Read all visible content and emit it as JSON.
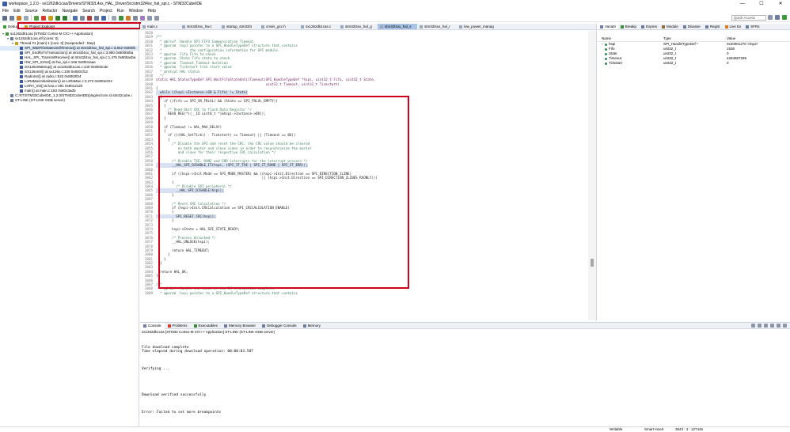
{
  "window": {
    "title": "workspace_1.2.0 - sx1262dk1cas/Drivers/STM32L4xx_HAL_Driver/Src/stm32l4xx_hal_spi.c - STM32CubeIDE",
    "minimize": "—",
    "maximize": "☐",
    "close": "✕"
  },
  "menu": [
    "File",
    "Edit",
    "Source",
    "Refactor",
    "Navigate",
    "Search",
    "Project",
    "Run",
    "Window",
    "Help"
  ],
  "toolbar": {
    "quick_access_placeholder": "Quick Access",
    "icon_colors": [
      "#5b6c8a",
      "#6f7f99",
      "#d47b22",
      "#9aa5b5",
      "#4f9a3c",
      "#d43b2f",
      "#c8a018",
      "#2f7e2f",
      "#2f7e2f",
      "#4f6fae",
      "#7f8aa0",
      "#b13a3a",
      "#6b7ca0",
      "#4466aa",
      "#9aa5b5",
      "#3f8f3f",
      "#d47b22",
      "#7f8aa0",
      "#a07ac8",
      "#8a97aa",
      "#8a97aa"
    ]
  },
  "debug_view": {
    "tabs": [
      {
        "label": "Debug",
        "icon": "bug-icon"
      },
      {
        "label": "Project Explorer",
        "icon": "folder-icon"
      }
    ],
    "tree": [
      {
        "indent": 0,
        "twisty": "▾",
        "icon_color": "#3a9a3a",
        "text": "sx1262dk1cas [STM32 Cortex-M C/C++ Application]",
        "selected": false
      },
      {
        "indent": 1,
        "twisty": "▾",
        "icon_color": "#6b7ca0",
        "text": "sx1262dk1cas.elf [cores: 0]",
        "selected": false
      },
      {
        "indent": 2,
        "twisty": "▾",
        "icon_color": "#c8a018",
        "text": "Thread #1 [main] 1 [core: 0] (Suspended : Step)",
        "selected": false
      },
      {
        "indent": 3,
        "twisty": "",
        "icon_color": "#3a5ca8",
        "text": "SPI_WaitFifoStateUntilTimeout() at stm32l4xx_hal_spi.c:3,842 0x800b",
        "selected": true
      },
      {
        "indent": 3,
        "twisty": "",
        "icon_color": "#3a5ca8",
        "text": "SPI_EndRxTxTransaction() at stm32l4xx_hal_spi.c:3,980 0x800b0ba",
        "selected": false
      },
      {
        "indent": 3,
        "twisty": "",
        "icon_color": "#3a5ca8",
        "text": "HAL_SPI_TransmitReceive() at stm32l4xx_hal_spi.c:1,475 0x800a4ba",
        "selected": false
      },
      {
        "indent": 3,
        "twisty": "",
        "icon_color": "#3a5ca8",
        "text": "HW_SPI_InOut() at hw_spi.c:166 0x8001aae",
        "selected": false
      },
      {
        "indent": 3,
        "twisty": "",
        "icon_color": "#3a5ca8",
        "text": "SX126xWakeup() at sx1262dk1cas.c:140 0x8002cde",
        "selected": false
      },
      {
        "indent": 3,
        "twisty": "",
        "icon_color": "#3a5ca8",
        "text": "SX126xInit() at sx126x.c:108 0x8001f12",
        "selected": false
      },
      {
        "indent": 3,
        "twisty": "",
        "icon_color": "#3a5ca8",
        "text": "RadioInit() at radio.c:523 0x8000f24",
        "selected": false
      },
      {
        "indent": 3,
        "twisty": "",
        "icon_color": "#3a5ca8",
        "text": "LoRaMacInitialization() at LoRaMac.c:3,273 0x800e224",
        "selected": false
      },
      {
        "indent": 3,
        "twisty": "",
        "icon_color": "#3a5ca8",
        "text": "LORA_Init() at lora.c:491 0x8012120",
        "selected": false
      },
      {
        "indent": 3,
        "twisty": "",
        "icon_color": "#3a5ca8",
        "text": "main() at main.c:183 0x8013ad0",
        "selected": false
      },
      {
        "indent": 1,
        "twisty": "",
        "icon_color": "#6b7ca0",
        "text": "C:/ST/STM32CubeIDE_1.2.0/STM32CubeIDE/plugins/com.st.stm32cube.i",
        "selected": false
      },
      {
        "indent": 1,
        "twisty": "",
        "icon_color": "#6b7ca0",
        "text": "ST-LINK (ST-LINK GDB server)",
        "selected": false
      }
    ]
  },
  "editor": {
    "tabs": [
      "main.c",
      "stm32l4xx_hw.c",
      "startup_stm32l4",
      "cmsis_gcc.h",
      "sx1262dk1cas.c",
      "stm32l4xx_hal_g",
      "stm32l4xx_hal_s",
      "stm32l4xx_hal_r",
      "low_power_manag"
    ],
    "active_tab": 6,
    "lines": [
      {
        "n": "3828",
        "t": "",
        "s": ""
      },
      {
        "n": "3829",
        "t": "/**",
        "s": "cmt"
      },
      {
        "n": "3830",
        "t": "  * @brief  Handle SPI FIFO Communication Timeout.",
        "s": "cmt"
      },
      {
        "n": "3831",
        "t": "  * @param  hspi pointer to a SPI_HandleTypeDef structure that contains",
        "s": "cmt"
      },
      {
        "n": "3832",
        "t": "  *              the configuration information for SPI module.",
        "s": "cmt"
      },
      {
        "n": "3833",
        "t": "  * @param  Fifo Fifo to check",
        "s": "cmt"
      },
      {
        "n": "3834",
        "t": "  * @param  State Fifo state to check",
        "s": "cmt"
      },
      {
        "n": "3835",
        "t": "  * @param  Timeout Timeout duration",
        "s": "cmt"
      },
      {
        "n": "3836",
        "t": "  * @param  Tickstart tick start value",
        "s": "cmt"
      },
      {
        "n": "3837",
        "t": "  * @retval HAL status",
        "s": "cmt"
      },
      {
        "n": "3838",
        "t": "  */",
        "s": "cmt"
      },
      {
        "n": "3839",
        "t": "static HAL_StatusTypeDef SPI_WaitFifoStateUntilTimeout(SPI_HandleTypeDef *hspi, uint32_t Fifo, uint32_t State,",
        "s": "kw"
      },
      {
        "n": "3840",
        "t": "                                                       uint32_t Timeout, uint32_t Tickstart)",
        "s": "kw"
      },
      {
        "n": "3841",
        "t": "{",
        "s": ""
      },
      {
        "n": "3842",
        "t": "  while ((hspi->Instance->SR & Fifo) != State)",
        "s": "hl"
      },
      {
        "n": "3843",
        "t": "  {",
        "s": ""
      },
      {
        "n": "3844",
        "t": "    if ((Fifo == SPI_SR_FRLVL) && (State == SPI_FRLVL_EMPTY))",
        "s": ""
      },
      {
        "n": "3845",
        "t": "    {",
        "s": ""
      },
      {
        "n": "3846",
        "t": "      /* Read 8bit CRC to flush Data Register */",
        "s": "cmt"
      },
      {
        "n": "3847",
        "t": "      READ_REG(*((__IO uint8_t *)&hspi->Instance->DR));",
        "s": ""
      },
      {
        "n": "3848",
        "t": "    }",
        "s": ""
      },
      {
        "n": "3849",
        "t": "",
        "s": ""
      },
      {
        "n": "3850",
        "t": "    if (Timeout != HAL_MAX_DELAY)",
        "s": ""
      },
      {
        "n": "3851",
        "t": "    {",
        "s": ""
      },
      {
        "n": "3852",
        "t": "      if (((HAL_GetTick() - Tickstart) >= Timeout) || (Timeout == 0U))",
        "s": ""
      },
      {
        "n": "3853",
        "t": "      {",
        "s": ""
      },
      {
        "n": "3854",
        "t": "        /* Disable the SPI and reset the CRC: the CRC value should be cleared",
        "s": "cmt"
      },
      {
        "n": "3855",
        "t": "           on both master and slave sides in order to resynchronize the master",
        "s": "cmt"
      },
      {
        "n": "3856",
        "t": "           and slave for their respective CRC calculation */",
        "s": "cmt"
      },
      {
        "n": "3857",
        "t": "",
        "s": ""
      },
      {
        "n": "3858",
        "t": "        /* Disable TXE, RXNE and ERR interrupts for the interrupt process */",
        "s": "cmt"
      },
      {
        "n": "3859",
        "t": "        __HAL_SPI_DISABLE_IT(hspi, (SPI_IT_TXE | SPI_IT_RXNE | SPI_IT_ERR));",
        "s": "hl"
      },
      {
        "n": "3860",
        "t": "",
        "s": ""
      },
      {
        "n": "3861",
        "t": "        if ((hspi->Init.Mode == SPI_MODE_MASTER) && ((hspi->Init.Direction == SPI_DIRECTION_1LINE)",
        "s": ""
      },
      {
        "n": "3862",
        "t": "                                                     || (hspi->Init.Direction == SPI_DIRECTION_2LINES_RXONLY)))",
        "s": ""
      },
      {
        "n": "3863",
        "t": "        {",
        "s": ""
      },
      {
        "n": "3864",
        "t": "          /* Disable SPI peripheral */",
        "s": "cmt"
      },
      {
        "n": "3865",
        "t": "          __HAL_SPI_DISABLE(hspi);",
        "s": "hl"
      },
      {
        "n": "3866",
        "t": "        }",
        "s": ""
      },
      {
        "n": "3867",
        "t": "",
        "s": ""
      },
      {
        "n": "3868",
        "t": "        /* Reset CRC Calculation */",
        "s": "cmt"
      },
      {
        "n": "3869",
        "t": "        if (hspi->Init.CRCCalculation == SPI_CRCCALCULATION_ENABLE)",
        "s": ""
      },
      {
        "n": "3870",
        "t": "        {",
        "s": ""
      },
      {
        "n": "3871",
        "t": "          SPI_RESET_CRC(hspi);",
        "s": "hl"
      },
      {
        "n": "3872",
        "t": "        }",
        "s": ""
      },
      {
        "n": "3873",
        "t": "",
        "s": ""
      },
      {
        "n": "3874",
        "t": "        hspi->State = HAL_SPI_STATE_READY;",
        "s": ""
      },
      {
        "n": "3875",
        "t": "",
        "s": ""
      },
      {
        "n": "3876",
        "t": "        /* Process Unlocked */",
        "s": "cmt"
      },
      {
        "n": "3877",
        "t": "        __HAL_UNLOCK(hspi);",
        "s": ""
      },
      {
        "n": "3878",
        "t": "",
        "s": ""
      },
      {
        "n": "3879",
        "t": "        return HAL_TIMEOUT;",
        "s": ""
      },
      {
        "n": "3880",
        "t": "      }",
        "s": ""
      },
      {
        "n": "3881",
        "t": "    }",
        "s": ""
      },
      {
        "n": "3882",
        "t": "  }",
        "s": ""
      },
      {
        "n": "3883",
        "t": "",
        "s": ""
      },
      {
        "n": "3884",
        "t": "  return HAL_OK;",
        "s": ""
      },
      {
        "n": "3885",
        "t": "}",
        "s": ""
      },
      {
        "n": "3886",
        "t": "",
        "s": ""
      },
      {
        "n": "3887",
        "t": "/**",
        "s": "cmt"
      },
      {
        "n": "3888",
        "t": "  * @brief  Handle the check of the RX transaction complete.",
        "s": "cmt"
      },
      {
        "n": "3889",
        "t": "  * @param  hspi pointer to a SPI_HandleTypeDef structure that contains",
        "s": "cmt"
      }
    ]
  },
  "variables_view": {
    "tabs": [
      {
        "label": "Variabl",
        "icon": "variables-icon",
        "color": "#6b7ca0"
      },
      {
        "label": "Breakp",
        "icon": "breakpoint-icon",
        "color": "#3a8a3a"
      },
      {
        "label": "Expres",
        "icon": "expressions-icon",
        "color": "#6b7ca0"
      },
      {
        "label": "Module",
        "icon": "module-icon",
        "color": "#8a6d3b"
      },
      {
        "label": "Disasse",
        "icon": "disassembly-icon",
        "color": "#6b7ca0"
      },
      {
        "label": "Regist",
        "icon": "registers-icon",
        "color": "#6b7ca0"
      },
      {
        "label": "Live Ex",
        "icon": "live-expressions-icon",
        "color": "#d47b22"
      },
      {
        "label": "SFRs",
        "icon": "sfr-icon",
        "color": "#6b7ca0"
      }
    ],
    "headers": [
      "Name",
      "Type",
      "Value"
    ],
    "rows": [
      {
        "name": "hspi",
        "twisty": "›",
        "type": "SPI_HandleTypeDef *",
        "value": "0x20001270 <hspi>"
      },
      {
        "name": "Fifo",
        "twisty": "",
        "type": "uint32_t",
        "value": "1536"
      },
      {
        "name": "State",
        "twisty": "",
        "type": "uint32_t",
        "value": "0"
      },
      {
        "name": "Timeout",
        "twisty": "",
        "type": "uint32_t",
        "value": "4294967295"
      },
      {
        "name": "Tickstart",
        "twisty": "",
        "type": "uint32_t",
        "value": "0"
      }
    ]
  },
  "console": {
    "tabs": [
      {
        "label": "Console",
        "icon": "console-icon",
        "color": "#6b7ca0"
      },
      {
        "label": "Problems",
        "icon": "problems-icon",
        "color": "#d43b2f"
      },
      {
        "label": "Executables",
        "icon": "executables-icon",
        "color": "#3a8a3a"
      },
      {
        "label": "Memory Browser",
        "icon": "memory-browser-icon",
        "color": "#6b7ca0"
      },
      {
        "label": "Debugger Console",
        "icon": "debugger-console-icon",
        "color": "#6b7ca0"
      },
      {
        "label": "Memory",
        "icon": "memory-icon",
        "color": "#6b7ca0"
      }
    ],
    "header": "sx1262dk1cas [STM32 Cortex-M C/C++ Application] ST-LINK (ST-LINK GDB server)",
    "lines": [
      "",
      "File download complete",
      "Time elapsed during download operation: 00:00:03.587",
      "",
      "",
      "",
      "Verifying ...",
      "",
      "",
      "",
      "",
      "",
      "Download verified successfully",
      "",
      "",
      "",
      "Error: Failed to set more breakpoints"
    ]
  },
  "statusbar": {
    "mode": "Writable",
    "insert": "Smart Insert",
    "position": "3843 : 4 : 127445"
  }
}
